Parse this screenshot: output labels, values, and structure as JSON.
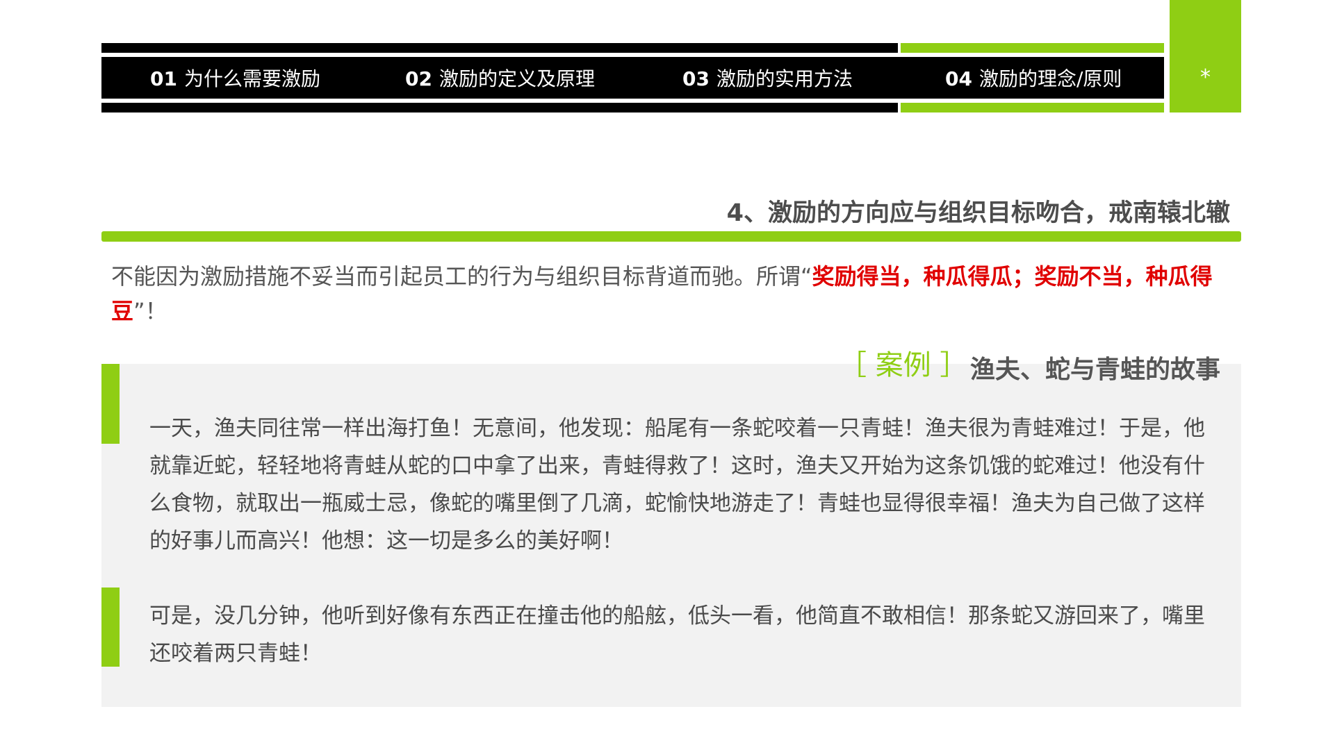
{
  "nav": {
    "tabs": [
      {
        "num": "01",
        "label": "为什么需要激励"
      },
      {
        "num": "02",
        "label": "激励的定义及原理"
      },
      {
        "num": "03",
        "label": "激励的实用方法"
      },
      {
        "num": "04",
        "label": "激励的理念/原则"
      }
    ],
    "marker": "*"
  },
  "section": {
    "heading": "4、激励的方向应与组织目标吻合，戒南辕北辙",
    "intro_before": "不能因为激励措施不妥当而引起员工的行为与组织目标背道而驰。所谓“",
    "intro_highlight": "奖励得当，种瓜得瓜；奖励不当，种瓜得豆",
    "intro_after": "”！"
  },
  "case": {
    "tag": "［ 案例 ］",
    "title": "渔夫、蛇与青蛙的故事",
    "paragraphs": [
      "一天，渔夫同往常一样出海打鱼！无意间，他发现：船尾有一条蛇咬着一只青蛙！渔夫很为青蛙难过！于是，他就靠近蛇，轻轻地将青蛙从蛇的口中拿了出来，青蛙得救了！这时，渔夫又开始为这条饥饿的蛇难过！他没有什么食物，就取出一瓶威士忌，像蛇的嘴里倒了几滴，蛇愉快地游走了！青蛙也显得很幸福！渔夫为自己做了这样的好事儿而高兴！他想：这一切是多么的美好啊！",
      "可是，没几分钟，他听到好像有东西正在撞击他的船舷，低头一看，他简直不敢相信！那条蛇又游回来了，嘴里还咬着两只青蛙！"
    ]
  },
  "colors": {
    "accent": "#8fce14",
    "highlight": "#e00000",
    "nav_bg": "#000000"
  }
}
